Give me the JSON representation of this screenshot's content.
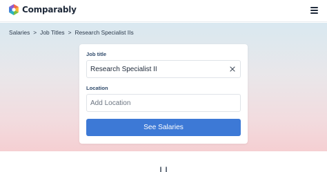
{
  "header": {
    "brand": "Comparably",
    "logo_icon": "comparably-logo-icon",
    "menu_icon": "hamburger-menu-icon"
  },
  "breadcrumb": {
    "items": [
      "Salaries",
      "Job Titles",
      "Research Specialist IIs"
    ],
    "separator": ">"
  },
  "search": {
    "job_title_label": "Job title",
    "job_title_value": "Research Specialist II",
    "clear_icon": "close-icon",
    "location_label": "Location",
    "location_placeholder": "Add Location",
    "submit_label": "See Salaries"
  },
  "below": {
    "heading_partial": "l l"
  },
  "colors": {
    "accent": "#3d79d6",
    "text_dark": "#1f2a3a",
    "label": "#2f4a6b",
    "hero_top": "#d9e8f0",
    "hero_bottom": "#f5cfd2"
  }
}
